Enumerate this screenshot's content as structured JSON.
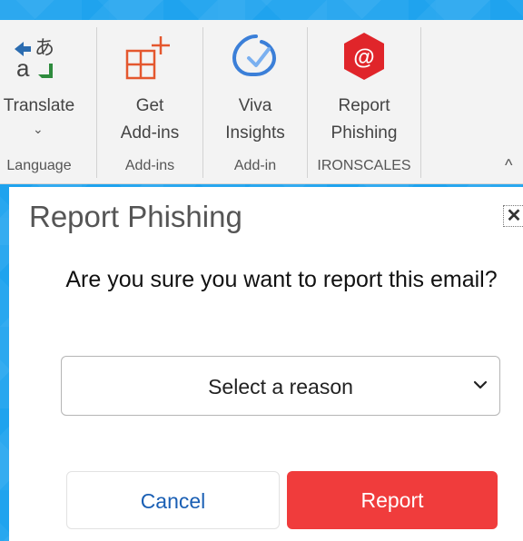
{
  "ribbon": {
    "groups": [
      {
        "label_line1": "Translate",
        "dropdown": true,
        "group_label": "Language",
        "icon": "translate-icon"
      },
      {
        "label_line1": "Get",
        "label_line2": "Add-ins",
        "group_label": "Add-ins",
        "icon": "get-add-ins-icon"
      },
      {
        "label_line1": "Viva",
        "label_line2": "Insights",
        "group_label": "Add-in",
        "icon": "viva-insights-icon"
      },
      {
        "label_line1": "Report",
        "label_line2": "Phishing",
        "group_label": "IRONSCALES",
        "icon": "ironscales-report-icon"
      }
    ],
    "collapse_glyph": "^"
  },
  "pane": {
    "title": "Report Phishing",
    "close_glyph": "✕",
    "question": "Are you sure you want to report this email?",
    "select_placeholder": "Select a reason",
    "cancel_label": "Cancel",
    "report_label": "Report"
  },
  "colors": {
    "background": "#1fa3ee",
    "report_button": "#f03c3c",
    "cancel_text": "#1a5fb4",
    "add_ins_icon": "#e4572e",
    "viva_icon": "#3b7fd8",
    "ironscales_icon": "#e0252a"
  }
}
